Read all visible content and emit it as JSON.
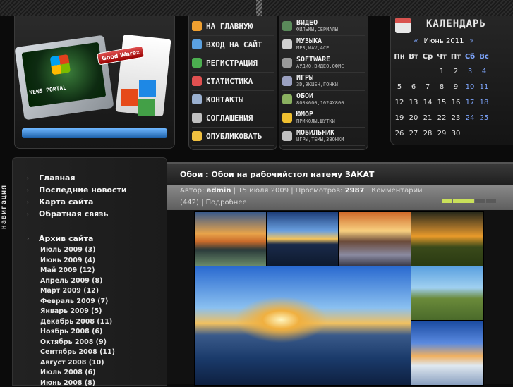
{
  "header": {
    "logo_badge": "Good Warez",
    "logo_title": "NEWS PORTAL"
  },
  "nav_main": [
    {
      "label": "На главную",
      "icon": "home-icon"
    },
    {
      "label": "Вход на сайт",
      "icon": "users-icon"
    },
    {
      "label": "Регистрация",
      "icon": "puzzle-icon"
    },
    {
      "label": "Статистика",
      "icon": "pie-chart-icon"
    },
    {
      "label": "Контакты",
      "icon": "mail-icon"
    },
    {
      "label": "Соглашения",
      "icon": "document-icon"
    },
    {
      "label": "Опубликовать",
      "icon": "pencil-icon"
    }
  ],
  "nav_categories": [
    {
      "title": "Видео",
      "sub": "фильмы,сериалы",
      "icon": "film-icon"
    },
    {
      "title": "Музыка",
      "sub": "mp3,wav,ace",
      "icon": "music-icon"
    },
    {
      "title": "Software",
      "sub": "аудио,видео,офис",
      "icon": "software-icon"
    },
    {
      "title": "Игры",
      "sub": "3d,экшен,гонки",
      "icon": "game-icon"
    },
    {
      "title": "Обои",
      "sub": "800x600,1024x800",
      "icon": "picture-icon"
    },
    {
      "title": "Юмор",
      "sub": "приколы,шутки",
      "icon": "smiley-icon"
    },
    {
      "title": "Мобильник",
      "sub": "игры,темы,звонки",
      "icon": "mobile-icon"
    }
  ],
  "calendar": {
    "title": "Календарь",
    "prev": "«",
    "next": "»",
    "month": "Июнь 2011",
    "weekdays": [
      "Пн",
      "Вт",
      "Ср",
      "Чт",
      "Пт",
      "Сб",
      "Вс"
    ],
    "weeks": [
      [
        "",
        "",
        "",
        "1",
        "2",
        "3",
        "4"
      ],
      [
        "5",
        "6",
        "7",
        "8",
        "9",
        "10",
        "11"
      ],
      [
        "12",
        "13",
        "14",
        "15",
        "16",
        "17",
        "18"
      ],
      [
        "19",
        "20",
        "21",
        "22",
        "23",
        "24",
        "25"
      ],
      [
        "26",
        "27",
        "28",
        "29",
        "30",
        "",
        ""
      ]
    ]
  },
  "sidebar": {
    "vertical_tab": "навигация",
    "links": [
      "Главная",
      "Последние новости",
      "Карта сайта",
      "Обратная связь"
    ],
    "archive_title": "Архив сайта",
    "archive": [
      "Июль 2009 (3)",
      "Июнь 2009 (4)",
      "Май 2009 (12)",
      "Апрель 2009 (8)",
      "Март 2009 (12)",
      "Февраль 2009 (7)",
      "Январь 2009 (5)",
      "Декабрь 2008 (11)",
      "Ноябрь 2008 (6)",
      "Октябрь 2008 (9)",
      "Сентябрь 2008 (11)",
      "Август 2008 (10)",
      "Июль 2008 (6)",
      "Июнь 2008 (8)"
    ]
  },
  "post": {
    "title": "Обои : Обои на рабочийстол натему ЗАКАТ",
    "author_label": "Автор:",
    "author": "admin",
    "sep1": " | ",
    "date": "15 июля 2009",
    "sep2": " | ",
    "views_label": "Просмотров:",
    "views": "2987",
    "sep3": " | ",
    "comments_label": "Комментарии",
    "comments_count": "(442)",
    "sep4": " | ",
    "more": "Подробнее",
    "rating": 3
  }
}
